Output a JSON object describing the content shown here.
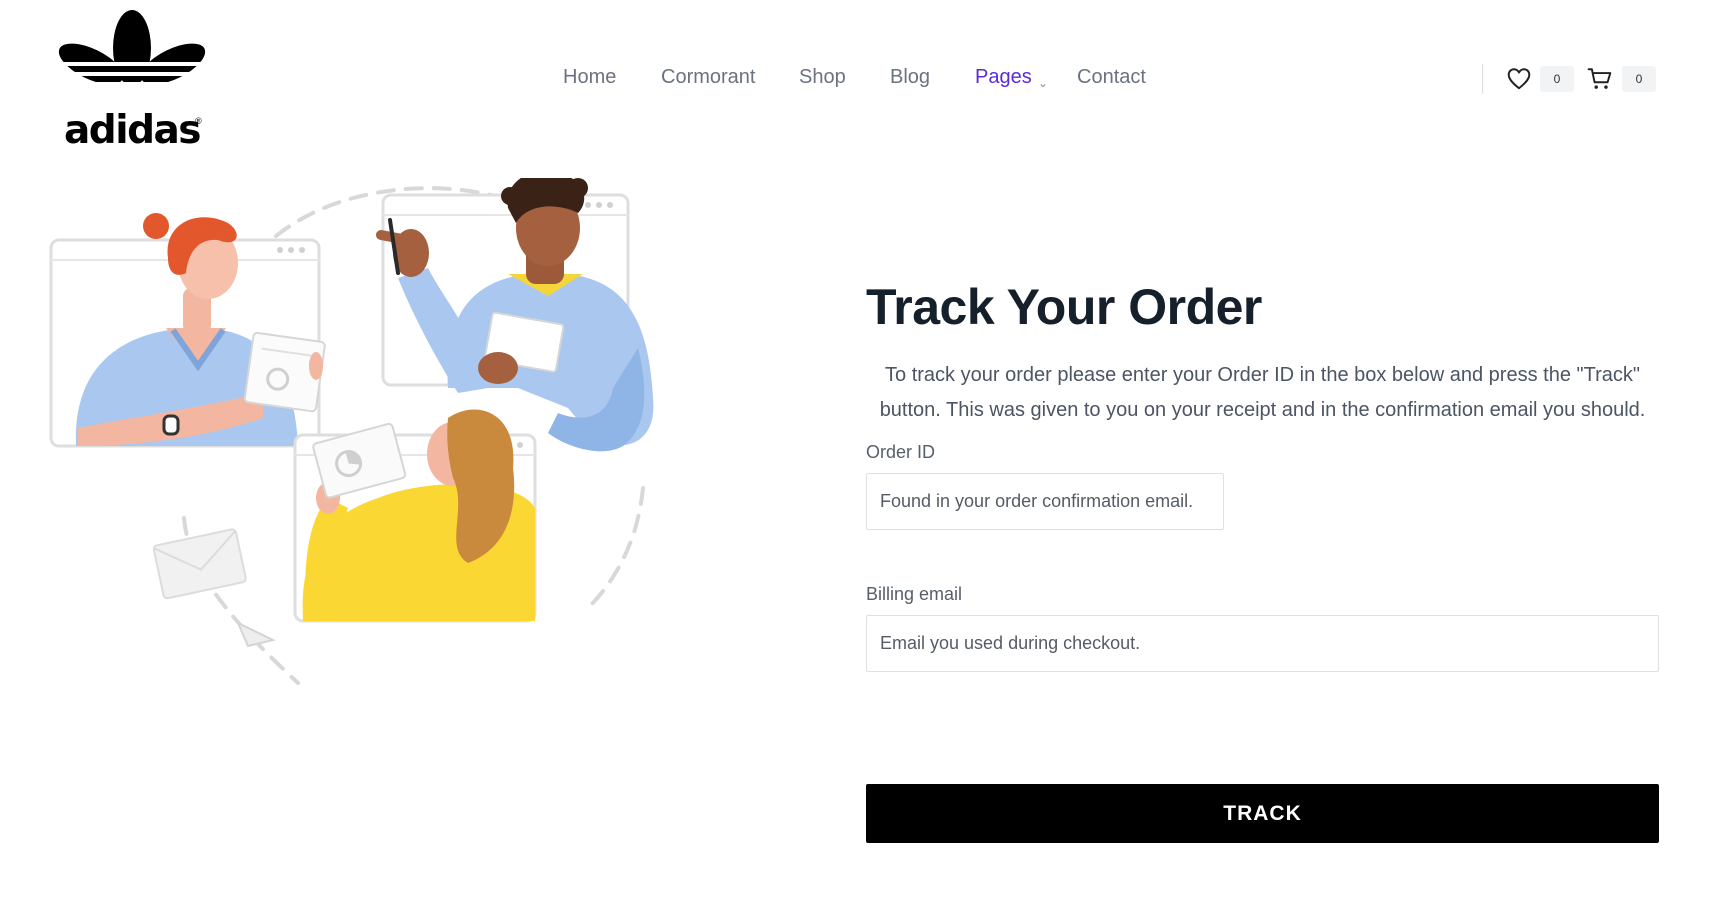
{
  "brand": {
    "logo_text": "adidas",
    "reg_mark": "®"
  },
  "nav": {
    "items": [
      {
        "label": "Home"
      },
      {
        "label": "Cormorant"
      },
      {
        "label": "Shop"
      },
      {
        "label": "Blog"
      },
      {
        "label": "Pages",
        "active": true,
        "has_dropdown": true,
        "caret": "⌄"
      },
      {
        "label": "Contact"
      }
    ]
  },
  "header_actions": {
    "wishlist_icon": "heart-icon",
    "wishlist_count": "0",
    "cart_icon": "cart-icon",
    "cart_count": "0"
  },
  "colors": {
    "accent": "#5b2bd6",
    "button_bg": "#000000",
    "button_text": "#ffffff",
    "title": "#15202b"
  },
  "track_form": {
    "title": "Track Your Order",
    "intro": "To track your order please enter your Order ID in the box below and press the \"Track\" button. This was given to you on your receipt and in the confirmation email you should.",
    "order_id_label": "Order ID",
    "order_id_placeholder": "Found in your order confirmation email.",
    "order_id_value": "",
    "billing_email_label": "Billing email",
    "billing_email_placeholder": "Email you used during checkout.",
    "billing_email_value": "",
    "submit_label": "TRACK"
  }
}
